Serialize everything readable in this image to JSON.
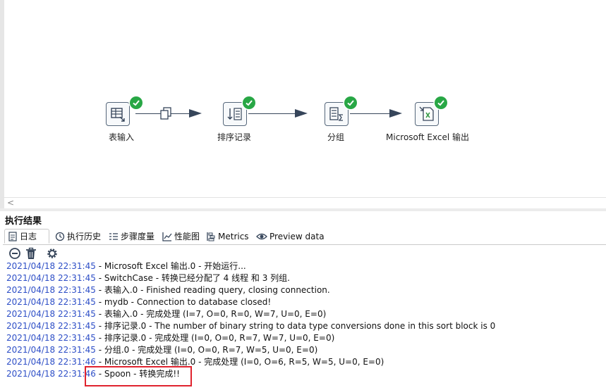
{
  "canvas": {
    "steps": [
      {
        "label": "表输入",
        "icon": "table-input-icon"
      },
      {
        "label": "排序记录",
        "icon": "sort-rows-icon"
      },
      {
        "label": "分组",
        "icon": "group-by-icon"
      },
      {
        "label": "Microsoft Excel 输出",
        "icon": "excel-output-icon"
      }
    ],
    "status_icon": "check-circle-icon",
    "hop_icon": "copy-rows-icon"
  },
  "results": {
    "title": "执行结果",
    "tabs": [
      {
        "label": "日志",
        "icon": "log-icon"
      },
      {
        "label": "执行历史",
        "icon": "history-icon"
      },
      {
        "label": "步骤度量",
        "icon": "step-metrics-icon"
      },
      {
        "label": "性能图",
        "icon": "performance-graph-icon"
      },
      {
        "label": "Metrics",
        "icon": "metrics-icon"
      },
      {
        "label": "Preview data",
        "icon": "preview-eye-icon"
      }
    ],
    "toolbar": [
      "clear-log-icon",
      "delete-icon",
      "settings-gear-icon"
    ],
    "log": [
      {
        "ts": "2021/04/18 22:31:45",
        "msg": " - Microsoft Excel 输出.0 - 开始运行..."
      },
      {
        "ts": "2021/04/18 22:31:45",
        "msg": " - SwitchCase - 转换已经分配了 4 线程 和 3 列组."
      },
      {
        "ts": "2021/04/18 22:31:45",
        "msg": " - 表输入.0 - Finished reading query, closing connection."
      },
      {
        "ts": "2021/04/18 22:31:45",
        "msg": " - mydb - Connection to database closed!"
      },
      {
        "ts": "2021/04/18 22:31:45",
        "msg": " - 表输入.0 - 完成处理 (I=7, O=0, R=0, W=7, U=0, E=0)"
      },
      {
        "ts": "2021/04/18 22:31:45",
        "msg": " - 排序记录.0 - The number of binary string to data type conversions done in this sort block is 0"
      },
      {
        "ts": "2021/04/18 22:31:45",
        "msg": " - 排序记录.0 - 完成处理 (I=0, O=0, R=7, W=7, U=0, E=0)"
      },
      {
        "ts": "2021/04/18 22:31:45",
        "msg": " - 分组.0 - 完成处理 (I=0, O=0, R=7, W=5, U=0, E=0)"
      },
      {
        "ts": "2021/04/18 22:31:46",
        "msg": " - Microsoft Excel 输出.0 - 完成处理 (I=0, O=6, R=5, W=5, U=0, E=0)"
      },
      {
        "ts": "2021/04/18 22:31:46",
        "msg": " - Spoon - 转换完成!!"
      }
    ]
  },
  "colors": {
    "timestamp": "#2e4fc7",
    "highlight": "#e0232e",
    "success": "#28a745",
    "hop": "#36455a"
  }
}
